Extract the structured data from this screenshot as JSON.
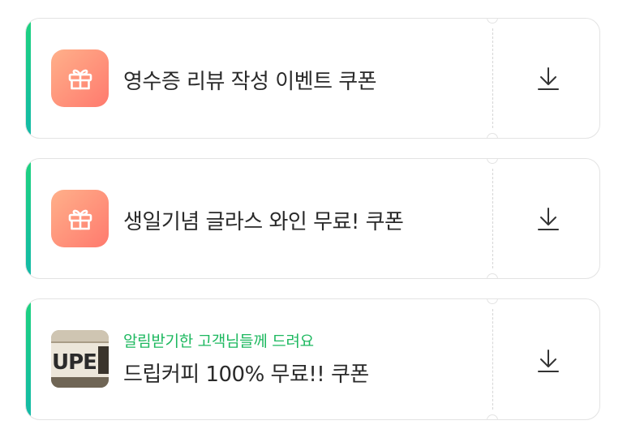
{
  "coupons": [
    {
      "title": "영수증 리뷰 작성 이벤트 쿠폰",
      "subtitle": "",
      "icon": "gift-icon",
      "download_icon": "download-icon"
    },
    {
      "title": "생일기념 글라스 와인 무료! 쿠폰",
      "subtitle": "",
      "icon": "gift-icon",
      "download_icon": "download-icon"
    },
    {
      "title": "드립커피 100% 무료!! 쿠폰",
      "subtitle": "알림받기한 고객님들께 드려요",
      "icon": "store-thumbnail",
      "download_icon": "download-icon"
    }
  ],
  "colors": {
    "accent_green": "#1ed27f",
    "icon_gradient_start": "#ffb08a",
    "icon_gradient_end": "#ff7a6e",
    "subtitle_green": "#1db85f",
    "border": "#e3e3e3"
  }
}
